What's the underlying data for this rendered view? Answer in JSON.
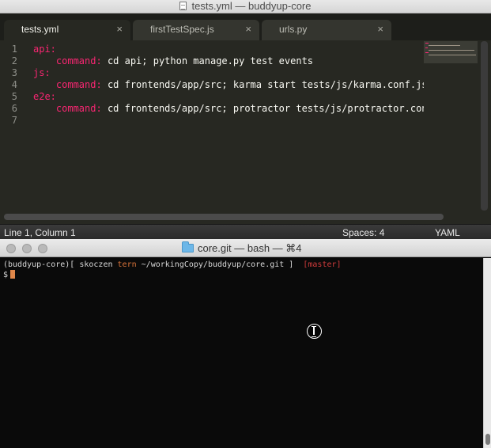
{
  "editor": {
    "title": "tests.yml — buddyup-core",
    "tabs": [
      {
        "label": "tests.yml",
        "close": "×"
      },
      {
        "label": "firstTestSpec.js",
        "close": "×"
      },
      {
        "label": "urls.py",
        "close": "×"
      }
    ],
    "line_numbers": [
      "1",
      "2",
      "3",
      "4",
      "5",
      "6",
      "7"
    ],
    "code": {
      "l1_key": "api:",
      "l2_key": "command:",
      "l2_val": "cd api; python manage.py test events",
      "l3_key": "js:",
      "l4_key": "command:",
      "l4_val": "cd frontends/app/src; karma start tests/js/karma.conf.js",
      "l5_key": "e2e:",
      "l6_key": "command:",
      "l6_val": "cd frontends/app/src; protractor tests/js/protractor.conf."
    },
    "status": {
      "position": "Line 1, Column 1",
      "spaces": "Spaces: 4",
      "syntax": "YAML"
    },
    "colors": {
      "keyword": "#f92672",
      "background": "#272822"
    }
  },
  "terminal": {
    "title": "core.git — bash — ⌘4",
    "prompt_env": "(buddyup-core)[",
    "prompt_user": "skoczen",
    "prompt_host": "tern",
    "prompt_path": "~/workingCopy/buddyup/core.git ]",
    "prompt_branch": "[master]",
    "prompt_symbol": "$",
    "scroll_fraction": 0.06
  }
}
